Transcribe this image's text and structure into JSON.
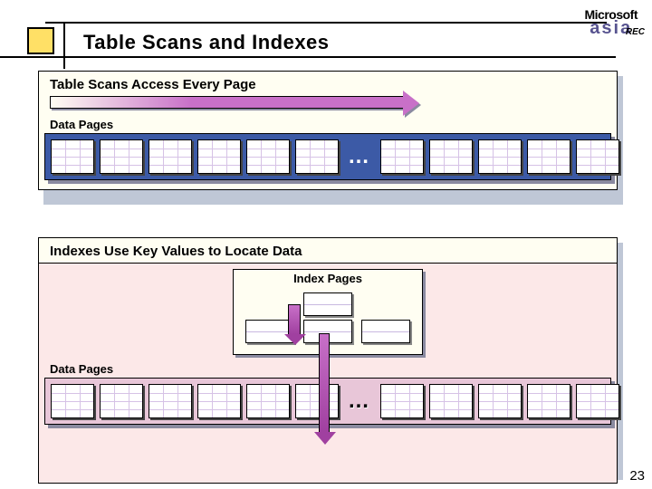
{
  "logo": {
    "line1": "Microsoft",
    "line2": "asia"
  },
  "rec": "REC",
  "title": "Table Scans and Indexes",
  "section1": {
    "heading": "Table Scans Access Every Page",
    "data_pages_label": "Data Pages",
    "ellipsis": "…"
  },
  "section2": {
    "heading": "Indexes Use Key Values to Locate Data",
    "index_pages_label": "Index Pages",
    "data_pages_label": "Data Pages",
    "ellipsis": "…"
  },
  "page_number": "23"
}
